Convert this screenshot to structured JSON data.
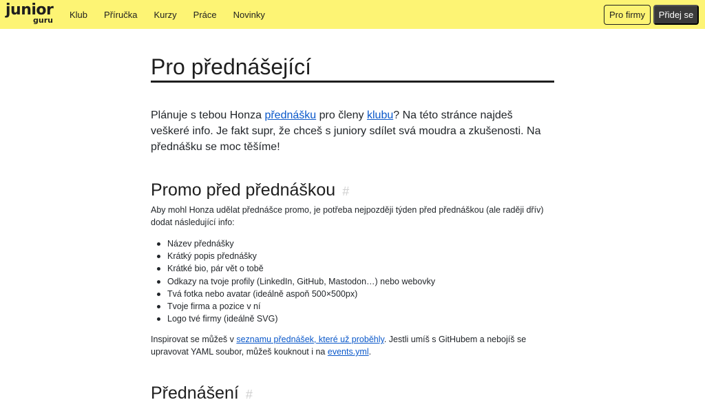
{
  "header": {
    "logo": {
      "main": "junior",
      "sub": "guru"
    },
    "nav": [
      "Klub",
      "Příručka",
      "Kurzy",
      "Práce",
      "Novinky"
    ],
    "btn_companies": "Pro firmy",
    "btn_join": "Přidej se"
  },
  "page": {
    "title": "Pro přednášející",
    "lead": {
      "t1": "Plánuje s tebou Honza ",
      "link1": "přednášku",
      "t2": " pro členy ",
      "link2": "klubu",
      "t3": "? Na této stránce najdeš veškeré info. Je fakt supr, že chceš s juniory sdílet svá moudra a zkušenosti. Na přednášku se moc těšíme!"
    },
    "promo": {
      "heading": "Promo před přednáškou",
      "anchor": "#",
      "intro": "Aby mohl Honza udělat přednášce promo, je potřeba nejpozději týden před přednáškou (ale raději dřív) dodat následující info:",
      "items": [
        "Název přednášky",
        "Krátký popis přednášky",
        "Krátké bio, pár vět o tobě",
        "Odkazy na tvoje profily (LinkedIn, GitHub, Mastodon…) nebo webovky",
        "Tvá fotka nebo avatar (ideálně aspoň 500×500px)",
        "Tvoje firma a pozice v ní",
        "Logo tvé firmy (ideálně SVG)"
      ],
      "outro": {
        "t1": "Inspirovat se můžeš v ",
        "link1": "seznamu přednášek, které už proběhly",
        "t2": ". Jestli umíš s GitHubem a nebojíš se upravovat YAML soubor, můžeš kouknout i na ",
        "link2": "events.yml",
        "t3": "."
      }
    },
    "speaking": {
      "heading": "Přednášení",
      "anchor": "#"
    }
  }
}
